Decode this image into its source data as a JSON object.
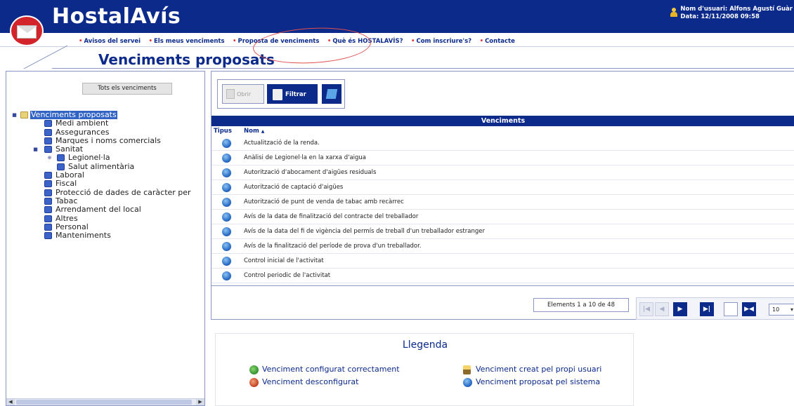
{
  "header": {
    "app_title": "HostalAvís",
    "user_label": "Nom d'usuari: Alfons Agustí Guàr",
    "date_label": "Data: 12/11/2008 09:58"
  },
  "nav": {
    "items": [
      {
        "label": "Avisos del servei"
      },
      {
        "label": "Els meus venciments"
      },
      {
        "label": "Proposta de venciments"
      },
      {
        "label": "Què és HOSTALAVÍS?"
      },
      {
        "label": "Com inscriure's?"
      },
      {
        "label": "Contacte"
      }
    ]
  },
  "page": {
    "title": "Venciments proposats"
  },
  "left": {
    "all_button": "Tots els venciments",
    "tree": [
      {
        "label": "Venciments proposats"
      },
      {
        "label": "Medi ambient"
      },
      {
        "label": "Assegurances"
      },
      {
        "label": "Marques i noms comercials"
      },
      {
        "label": "Sanitat"
      },
      {
        "label": "Legionel·la"
      },
      {
        "label": "Salut alimentària"
      },
      {
        "label": "Laboral"
      },
      {
        "label": "Fiscal"
      },
      {
        "label": "Protecció de dades de caràcter per"
      },
      {
        "label": "Tabac"
      },
      {
        "label": "Arrendament del local"
      },
      {
        "label": "Altres"
      },
      {
        "label": "Personal"
      },
      {
        "label": "Manteniments"
      }
    ]
  },
  "toolbar": {
    "open_label": "Obrir",
    "filter_label": "Filtrar"
  },
  "grid": {
    "title": "Venciments",
    "col_type": "Tipus",
    "col_name": "Nom",
    "sort_indicator": "▲",
    "rows": [
      {
        "name": "Actualització de la renda."
      },
      {
        "name": "Anàlisi de Legionel·la en la xarxa d'aigua"
      },
      {
        "name": "Autorització d'abocament d'aigües residuals"
      },
      {
        "name": "Autorització de captació d'aigües"
      },
      {
        "name": "Autorització de punt de venda de tabac amb recàrrec"
      },
      {
        "name": "Avís de la data de finalització del contracte del treballador"
      },
      {
        "name": "Avís de la data del fi de vigència del permís de treball d'un treballador estranger"
      },
      {
        "name": "Avís de la finalització del període de prova d'un treballador."
      },
      {
        "name": "Control inicial de l'activitat"
      },
      {
        "name": "Control periodic de l'activitat"
      }
    ]
  },
  "pager": {
    "info": "Elements 1 a 10 de 48",
    "page_size": "10"
  },
  "legend": {
    "title": "Llegenda",
    "items": [
      {
        "label": "Venciment configurat correctament"
      },
      {
        "label": "Venciment desconfigurat"
      },
      {
        "label": "Venciment creat pel propi usuari"
      },
      {
        "label": "Venciment proposat pel sistema"
      }
    ]
  },
  "colors": {
    "brand": "#0b2a8a",
    "highlight": "#3163c5",
    "annotation": "#e05050"
  }
}
